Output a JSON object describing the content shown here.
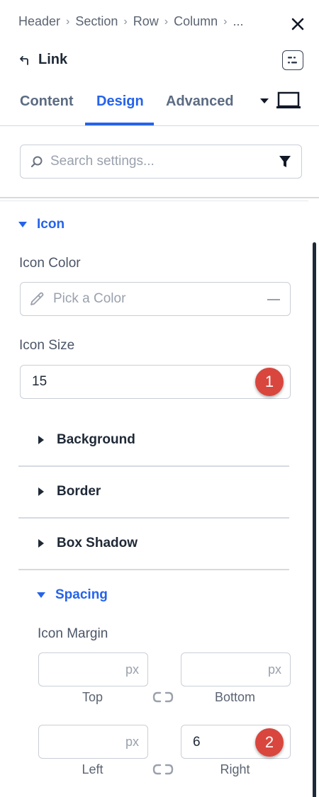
{
  "breadcrumb": {
    "items": [
      "Header",
      "Section",
      "Row",
      "Column",
      "..."
    ]
  },
  "module": {
    "title": "Link"
  },
  "tabs": [
    {
      "label": "Content"
    },
    {
      "label": "Design",
      "active": true
    },
    {
      "label": "Advanced"
    }
  ],
  "search": {
    "placeholder": "Search settings..."
  },
  "icon_section": {
    "title": "Icon",
    "color_label": "Icon Color",
    "color_placeholder": "Pick a Color",
    "size_label": "Icon Size",
    "size_value": "15",
    "size_badge": "1"
  },
  "subsections": [
    {
      "title": "Background"
    },
    {
      "title": "Border"
    },
    {
      "title": "Box Shadow"
    },
    {
      "title": "Spacing"
    }
  ],
  "spacing": {
    "margin_label": "Icon Margin",
    "unit": "px",
    "top": {
      "label": "Top",
      "value": ""
    },
    "bottom": {
      "label": "Bottom",
      "value": ""
    },
    "left": {
      "label": "Left",
      "value": ""
    },
    "right": {
      "label": "Right",
      "value": "6"
    },
    "right_badge": "2"
  },
  "colors": {
    "accent": "#2563eb",
    "badge": "#d9463e"
  }
}
